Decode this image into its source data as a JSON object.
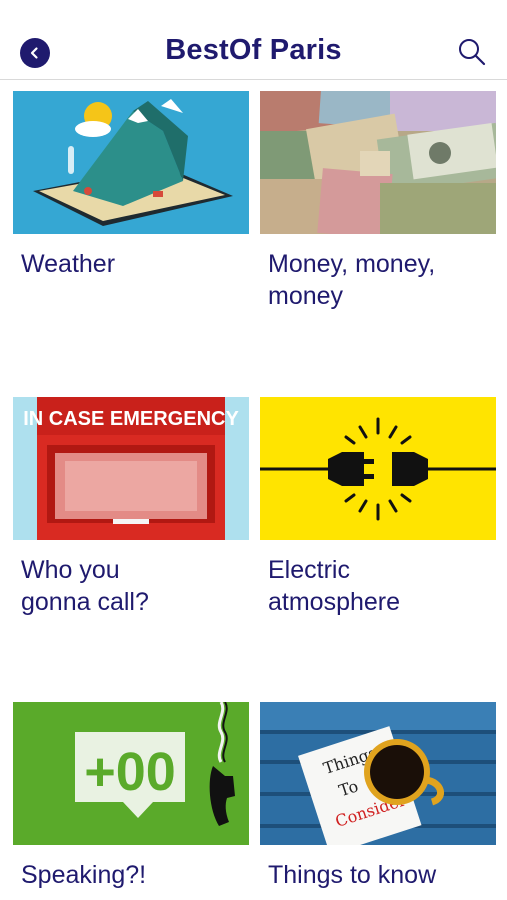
{
  "header": {
    "title": "BestOf Paris",
    "back_icon": "back-arrow-icon",
    "search_icon": "search-icon",
    "accent_color": "#1f1a6e"
  },
  "cards": [
    {
      "label_lines": [
        "Weather"
      ],
      "image": "weather-illustration"
    },
    {
      "label_lines": [
        "Money, money,",
        "money"
      ],
      "image": "banknotes-photo"
    },
    {
      "label_lines": [
        "Who you",
        "gonna call?"
      ],
      "image": "emergency-box-image",
      "image_text": "IN CASE EMERGENCY"
    },
    {
      "label_lines": [
        "Electric",
        "atmosphere"
      ],
      "image": "plug-socket-icon"
    },
    {
      "label_lines": [
        "Speaking?!"
      ],
      "image": "phone-code-image",
      "image_text": "+00"
    },
    {
      "label_lines": [
        "Things to know"
      ],
      "image": "coffee-note-photo",
      "image_text_lines": [
        "Things",
        "To",
        "Consider"
      ]
    }
  ]
}
